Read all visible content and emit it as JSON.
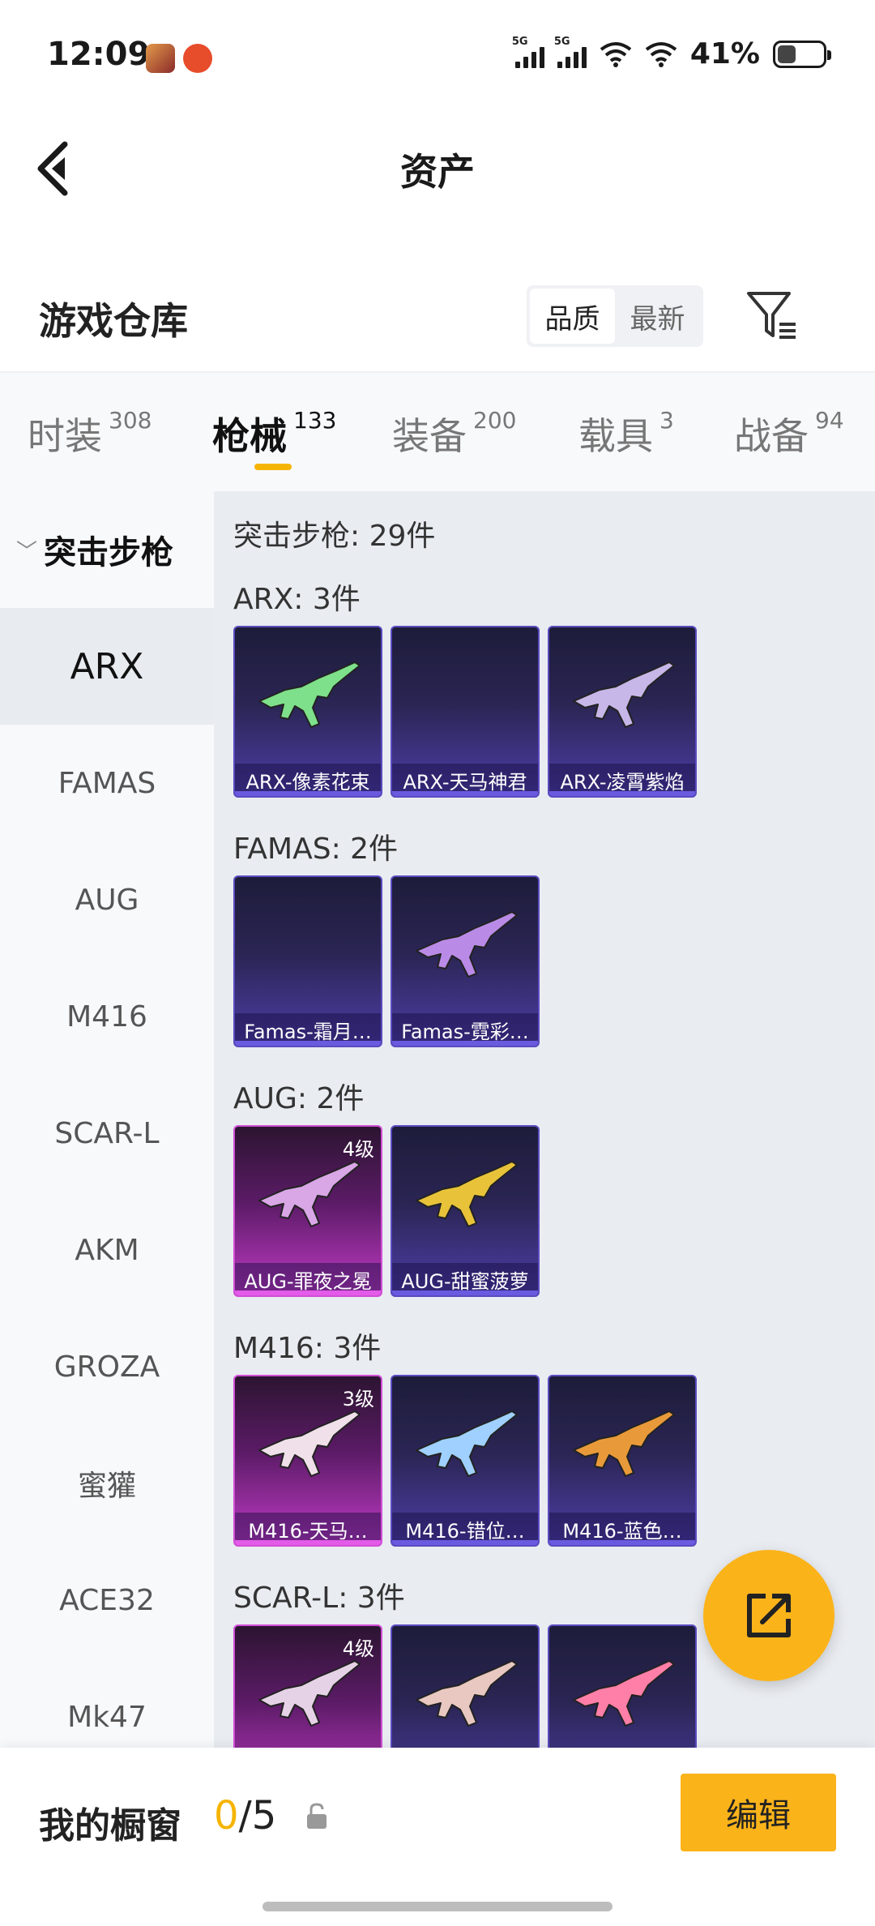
{
  "status": {
    "time": "12:09",
    "battery": "41%",
    "battery_level": 0.41,
    "sig1": "5G",
    "sig2": "5G"
  },
  "header": {
    "title": "资产"
  },
  "section": {
    "title": "游戏仓库",
    "sort_options": [
      {
        "label": "品质",
        "active": true
      },
      {
        "label": "最新",
        "active": false
      }
    ]
  },
  "tabs": [
    {
      "label": "时装",
      "count": "308",
      "active": false
    },
    {
      "label": "枪械",
      "count": "133",
      "active": true
    },
    {
      "label": "装备",
      "count": "200",
      "active": false
    },
    {
      "label": "载具",
      "count": "3",
      "active": false
    },
    {
      "label": "战备",
      "count": "94",
      "active": false
    }
  ],
  "sidebar": {
    "group": "突击步枪",
    "items": [
      "ARX",
      "FAMAS",
      "AUG",
      "M416",
      "SCAR-L",
      "AKM",
      "GROZA",
      "蜜獾",
      "ACE32",
      "Mk47"
    ],
    "active_index": 0
  },
  "content": {
    "summary": "突击步枪: 29件",
    "groups": [
      {
        "title": "ARX: 3件",
        "items": [
          {
            "name": "ARX-像素花束",
            "level": "",
            "rare": false,
            "gun_color": "#7ee08a"
          },
          {
            "name": "ARX-天马神君",
            "level": "",
            "rare": false,
            "gun_color": ""
          },
          {
            "name": "ARX-凌霄紫焰",
            "level": "",
            "rare": false,
            "gun_color": "#c7b6e8"
          }
        ]
      },
      {
        "title": "FAMAS: 2件",
        "items": [
          {
            "name": "Famas-霜月…",
            "level": "",
            "rare": false,
            "gun_color": ""
          },
          {
            "name": "Famas-霓彩…",
            "level": "",
            "rare": false,
            "gun_color": "#b98be6"
          }
        ]
      },
      {
        "title": "AUG: 2件",
        "items": [
          {
            "name": "AUG-罪夜之冕",
            "level": "4级",
            "rare": true,
            "gun_color": "#d9a6e6"
          },
          {
            "name": "AUG-甜蜜菠萝",
            "level": "",
            "rare": false,
            "gun_color": "#e8c33a"
          }
        ]
      },
      {
        "title": "M416: 3件",
        "items": [
          {
            "name": "M416-天马…",
            "level": "3级",
            "rare": true,
            "gun_color": "#f0e0ea"
          },
          {
            "name": "M416-错位…",
            "level": "",
            "rare": false,
            "gun_color": "#9fd0ff"
          },
          {
            "name": "M416-蓝色…",
            "level": "",
            "rare": false,
            "gun_color": "#e89a3a"
          }
        ]
      },
      {
        "title": "SCAR-L: 3件",
        "items": [
          {
            "name": "",
            "level": "4级",
            "rare": true,
            "gun_color": "#e6d2e6"
          },
          {
            "name": "",
            "level": "",
            "rare": false,
            "gun_color": "#e8c8c0"
          },
          {
            "name": "",
            "level": "",
            "rare": false,
            "gun_color": "#ff7fa8"
          }
        ]
      }
    ]
  },
  "bottom": {
    "label": "我的橱窗",
    "count_current": "0",
    "count_total": "/5",
    "edit_label": "编辑"
  },
  "colors": {
    "accent": "#fbb31a",
    "rare_border": "#d14fd6",
    "common_border": "#5a4bc0"
  }
}
